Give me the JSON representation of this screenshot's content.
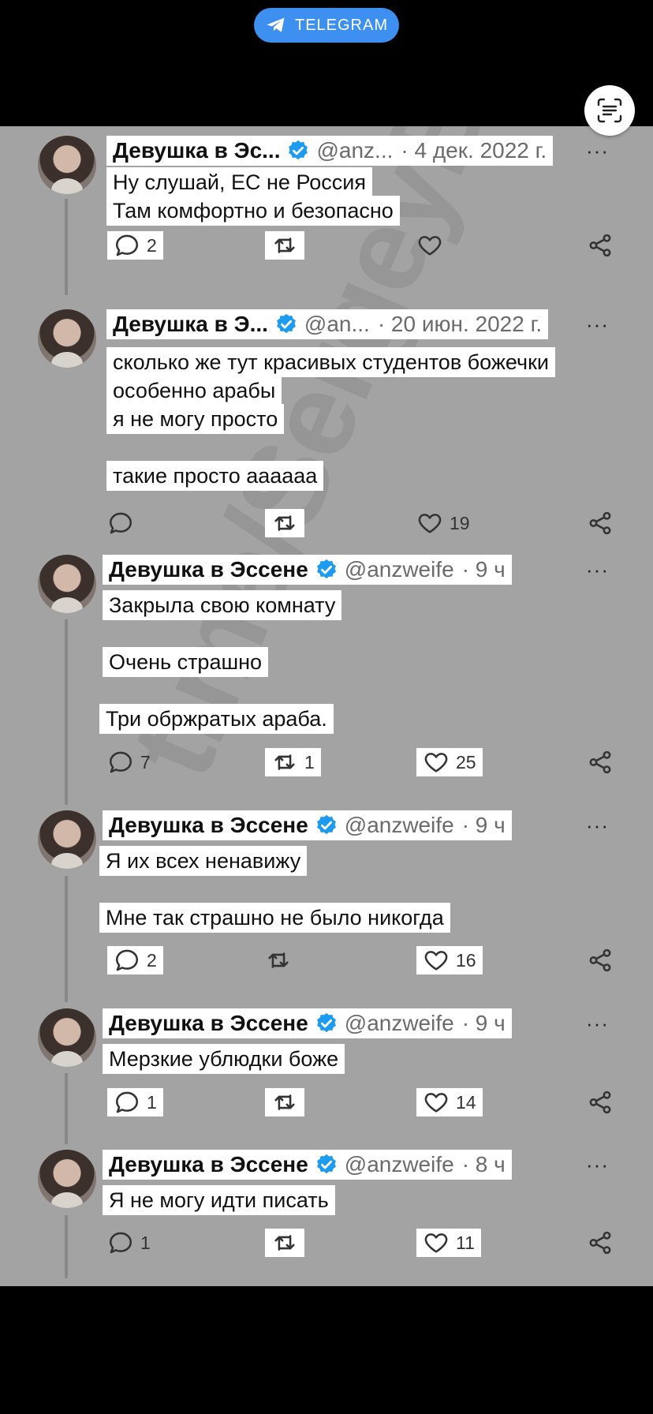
{
  "top": {
    "channel_label": "TELEGRAM"
  },
  "watermark": "t.me/SergeyBraska",
  "tweets": [
    {
      "name": "Девушка в Эс...",
      "handle": "@anz...",
      "time": "· 4 дек. 2022 г.",
      "lines": [
        "Ну слушай, ЕС не Россия",
        "Там комфортно и безопасно"
      ],
      "replies": "2",
      "retweets": "",
      "likes": ""
    },
    {
      "name": "Девушка в Э...",
      "handle": "@an...",
      "time": "· 20 июн. 2022 г.",
      "lines": [
        "сколько же тут красивых студентов божечки",
        "особенно арабы",
        "я не могу просто",
        "такие просто аааааа"
      ],
      "replies": "",
      "retweets": "",
      "likes": "19"
    },
    {
      "name": "Девушка в Эссене",
      "handle": "@anzweife",
      "time": "· 9 ч",
      "lines": [
        "Закрыла свою комнату",
        "Очень страшно",
        "Три обржратых араба."
      ],
      "replies": "7",
      "retweets": "1",
      "likes": "25"
    },
    {
      "name": "Девушка в Эссене",
      "handle": "@anzweife",
      "time": "· 9 ч",
      "lines": [
        "Я их всех ненавижу",
        "Мне так страшно не было никогда"
      ],
      "replies": "2",
      "retweets": "",
      "likes": "16"
    },
    {
      "name": "Девушка в Эссене",
      "handle": "@anzweife",
      "time": "· 9 ч",
      "lines": [
        "Мерзкие ублюдки боже"
      ],
      "replies": "1",
      "retweets": "",
      "likes": "14"
    },
    {
      "name": "Девушка в Эссене",
      "handle": "@anzweife",
      "time": "· 8 ч",
      "lines": [
        "Я не могу идти писать"
      ],
      "replies": "1",
      "retweets": "",
      "likes": "11"
    }
  ],
  "more_icon": "···",
  "colors": {
    "verified": "#1d9bf0",
    "telegram": "#3d8ff0",
    "background": "#a3a3a3"
  }
}
